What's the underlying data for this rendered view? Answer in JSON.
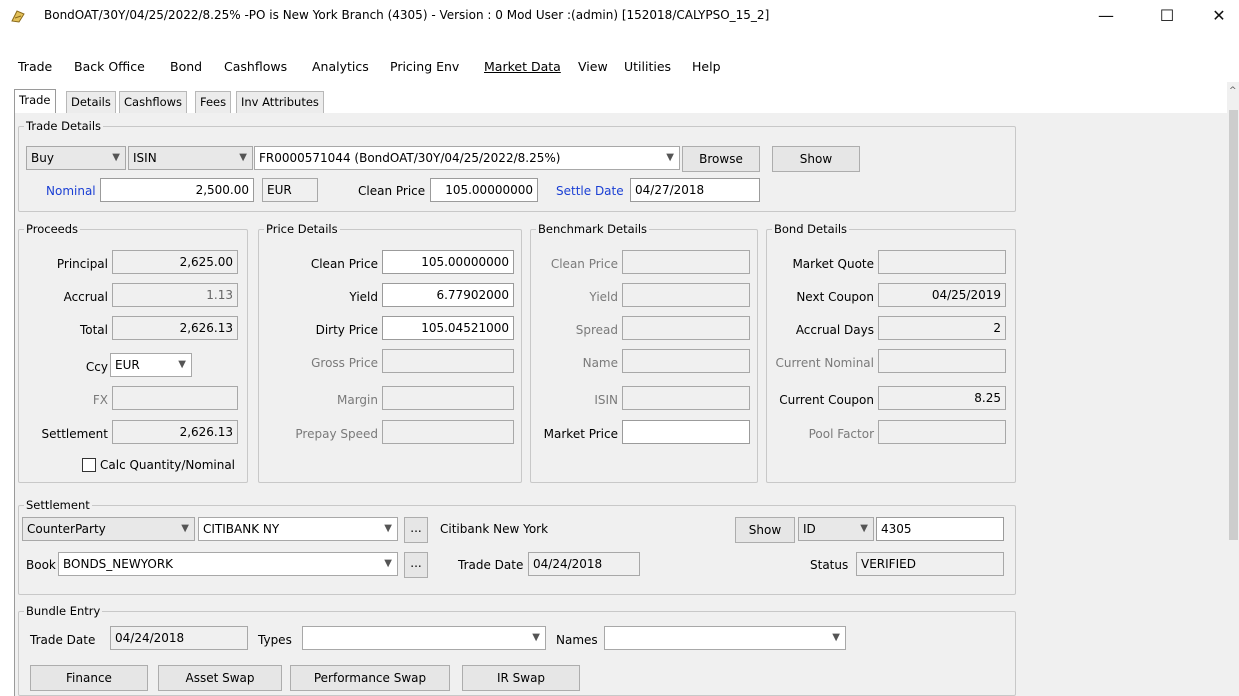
{
  "window": {
    "title": "BondOAT/30Y/04/25/2022/8.25%  -PO is New York Branch  (4305) - Version : 0 Mod User :(admin)  [152018/CALYPSO_15_2]",
    "min": "—",
    "max": "☐",
    "close": "✕"
  },
  "menu": [
    "Trade",
    "Back Office",
    "Bond",
    "Cashflows",
    "Analytics",
    "Pricing Env",
    "Market Data",
    "View",
    "Utilities",
    "Help"
  ],
  "tabs": [
    "Trade",
    "Details",
    "Cashflows",
    "Fees",
    "Inv Attributes"
  ],
  "trade_details": {
    "title": "Trade Details",
    "direction": "Buy",
    "id_type": "ISIN",
    "security": "FR0000571044 (BondOAT/30Y/04/25/2022/8.25%)",
    "browse": "Browse",
    "show": "Show",
    "nominal_label": "Nominal",
    "nominal": "2,500.00",
    "currency": "EUR",
    "clean_price_label": "Clean Price",
    "clean_price": "105.00000000",
    "settle_date_label": "Settle Date",
    "settle_date": "04/27/2018"
  },
  "proceeds": {
    "title": "Proceeds",
    "principal_label": "Principal",
    "principal": "2,625.00",
    "accrual_label": "Accrual",
    "accrual": "1.13",
    "total_label": "Total",
    "total": "2,626.13",
    "ccy_label": "Ccy",
    "ccy": "EUR",
    "fx_label": "FX",
    "fx": "",
    "settlement_label": "Settlement",
    "settlement": "2,626.13",
    "calc_label": "Calc Quantity/Nominal"
  },
  "price_details": {
    "title": "Price Details",
    "clean_label": "Clean Price",
    "clean": "105.00000000",
    "yield_label": "Yield",
    "yield": "6.77902000",
    "dirty_label": "Dirty Price",
    "dirty": "105.04521000",
    "gross_label": "Gross Price",
    "gross": "",
    "margin_label": "Margin",
    "margin": "",
    "prepay_label": "Prepay Speed",
    "prepay": ""
  },
  "benchmark": {
    "title": "Benchmark Details",
    "clean_label": "Clean Price",
    "yield_label": "Yield",
    "spread_label": "Spread",
    "name_label": "Name",
    "isin_label": "ISIN",
    "market_label": "Market Price"
  },
  "bond_details": {
    "title": "Bond Details",
    "quote_label": "Market Quote",
    "quote": "",
    "next_coupon_label": "Next Coupon",
    "next_coupon": "04/25/2019",
    "accrual_days_label": "Accrual Days",
    "accrual_days": "2",
    "current_nominal_label": "Current Nominal",
    "current_nominal": "",
    "current_coupon_label": "Current Coupon",
    "current_coupon": "8.25",
    "pool_factor_label": "Pool Factor",
    "pool_factor": ""
  },
  "settlement": {
    "title": "Settlement",
    "cp_type": "CounterParty",
    "cp": "CITIBANK NY",
    "ellipsis": "...",
    "cp_name": "Citibank New York",
    "show": "Show",
    "id_type": "ID",
    "id": "4305",
    "book_label": "Book",
    "book": "BONDS_NEWYORK",
    "trade_date_label": "Trade Date",
    "trade_date": "04/24/2018",
    "status_label": "Status",
    "status": "VERIFIED"
  },
  "bundle": {
    "title": "Bundle Entry",
    "trade_date_label": "Trade Date",
    "trade_date": "04/24/2018",
    "types_label": "Types",
    "types": "",
    "names_label": "Names",
    "names": "",
    "buttons": [
      "Finance",
      "Asset Swap",
      "Performance Swap",
      "IR Swap"
    ]
  }
}
